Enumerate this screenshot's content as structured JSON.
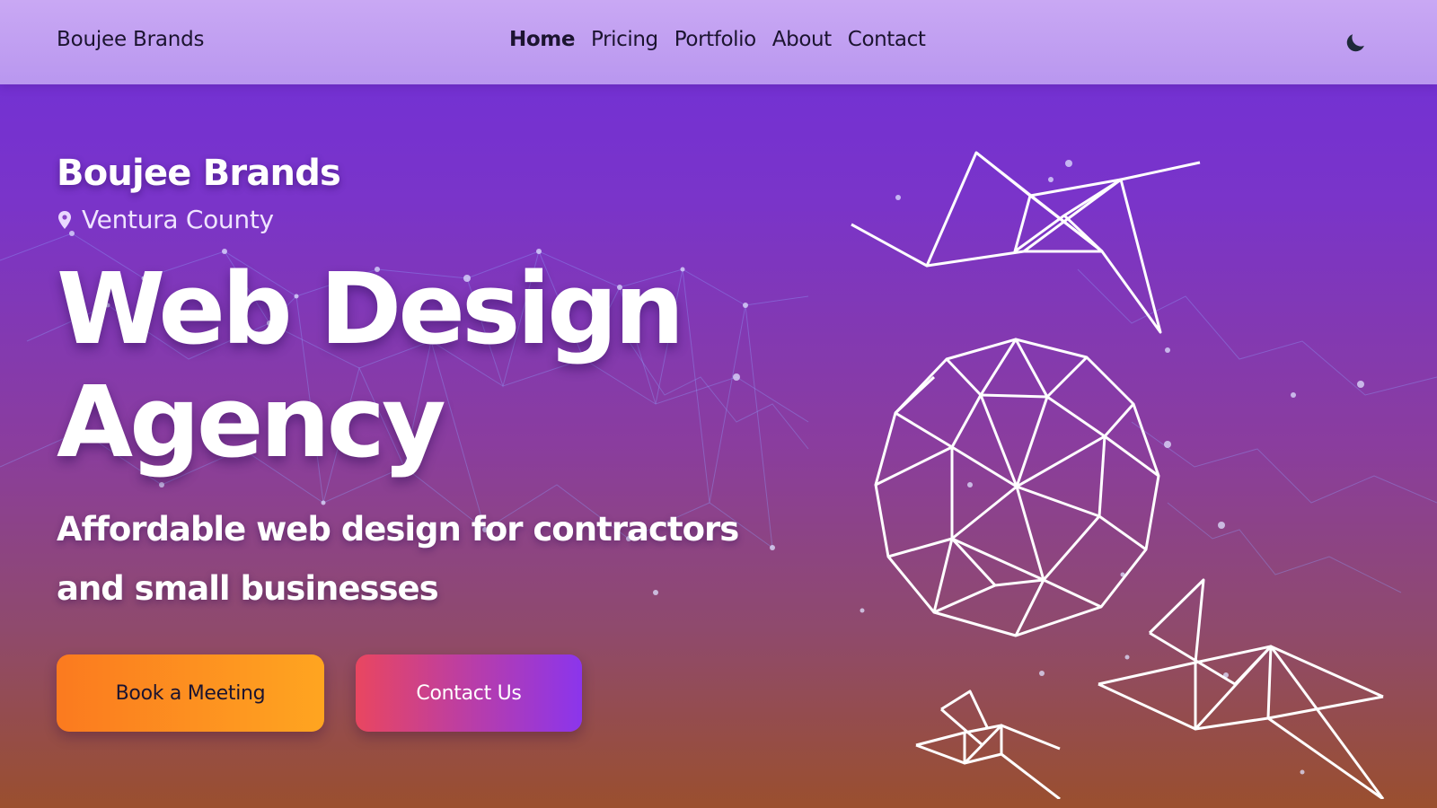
{
  "navbar": {
    "brand": "Boujee Brands",
    "links": [
      {
        "label": "Home",
        "active": true
      },
      {
        "label": "Pricing",
        "active": false
      },
      {
        "label": "Portfolio",
        "active": false
      },
      {
        "label": "About",
        "active": false
      },
      {
        "label": "Contact",
        "active": false
      }
    ],
    "theme_toggle_icon": "moon-icon"
  },
  "hero": {
    "brand": "Boujee Brands",
    "location_icon": "map-pin-icon",
    "location": "Ventura County",
    "headline_line1": "Web Design",
    "headline_line2": "Agency",
    "subheadline_line1": "Affordable web design for contractors",
    "subheadline_line2": "and small businesses",
    "primary_cta": "Book a Meeting",
    "secondary_cta": "Contact Us"
  },
  "colors": {
    "nav_bg": "#c0a0f2",
    "hero_top": "#6f2fd9",
    "hero_bottom": "#9a4f2e",
    "primary_button": "#fb8c1f",
    "secondary_button_start": "#e94660",
    "secondary_button_end": "#8b35ec",
    "text_dark": "#1c1430"
  }
}
